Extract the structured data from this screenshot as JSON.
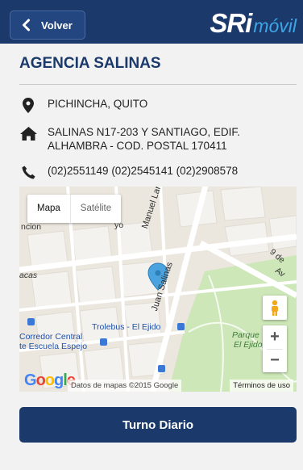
{
  "header": {
    "back_label": "Volver",
    "logo_primary": "SRi",
    "logo_secondary": "móvil"
  },
  "agency": {
    "title": "AGENCIA SALINAS",
    "location": "PICHINCHA, QUITO",
    "address_line1": "SALINAS N17-203 Y SANTIAGO, EDIF.",
    "address_line2": "ALHAMBRA - COD. POSTAL 170411",
    "phones": "(02)2551149 (02)2545141 (02)2908578"
  },
  "map": {
    "type_map": "Mapa",
    "type_satellite": "Satélite",
    "street_larrea": "Manuel Larrea",
    "street_salinas": "Juan Salinas",
    "label_ncion": "ncion",
    "label_ayo": "yo",
    "label_acas": "acas",
    "label_9de": "9 de",
    "label_av": "Av",
    "label_trolebus": "Trolebus - El Ejido",
    "label_corredor1": "Corredor Central",
    "label_corredor2": "te Escuela Espejo",
    "label_parque1": "Parque",
    "label_parque2": "El Ejido",
    "attribution": "Datos de mapas ©2015 Google",
    "terms": "Términos de uso",
    "google": "Google",
    "zoom_in": "+",
    "zoom_out": "−"
  },
  "action": {
    "turno_label": "Turno Diario"
  },
  "colors": {
    "primary": "#1b3a6b",
    "logo_accent": "#3ea6e6"
  }
}
